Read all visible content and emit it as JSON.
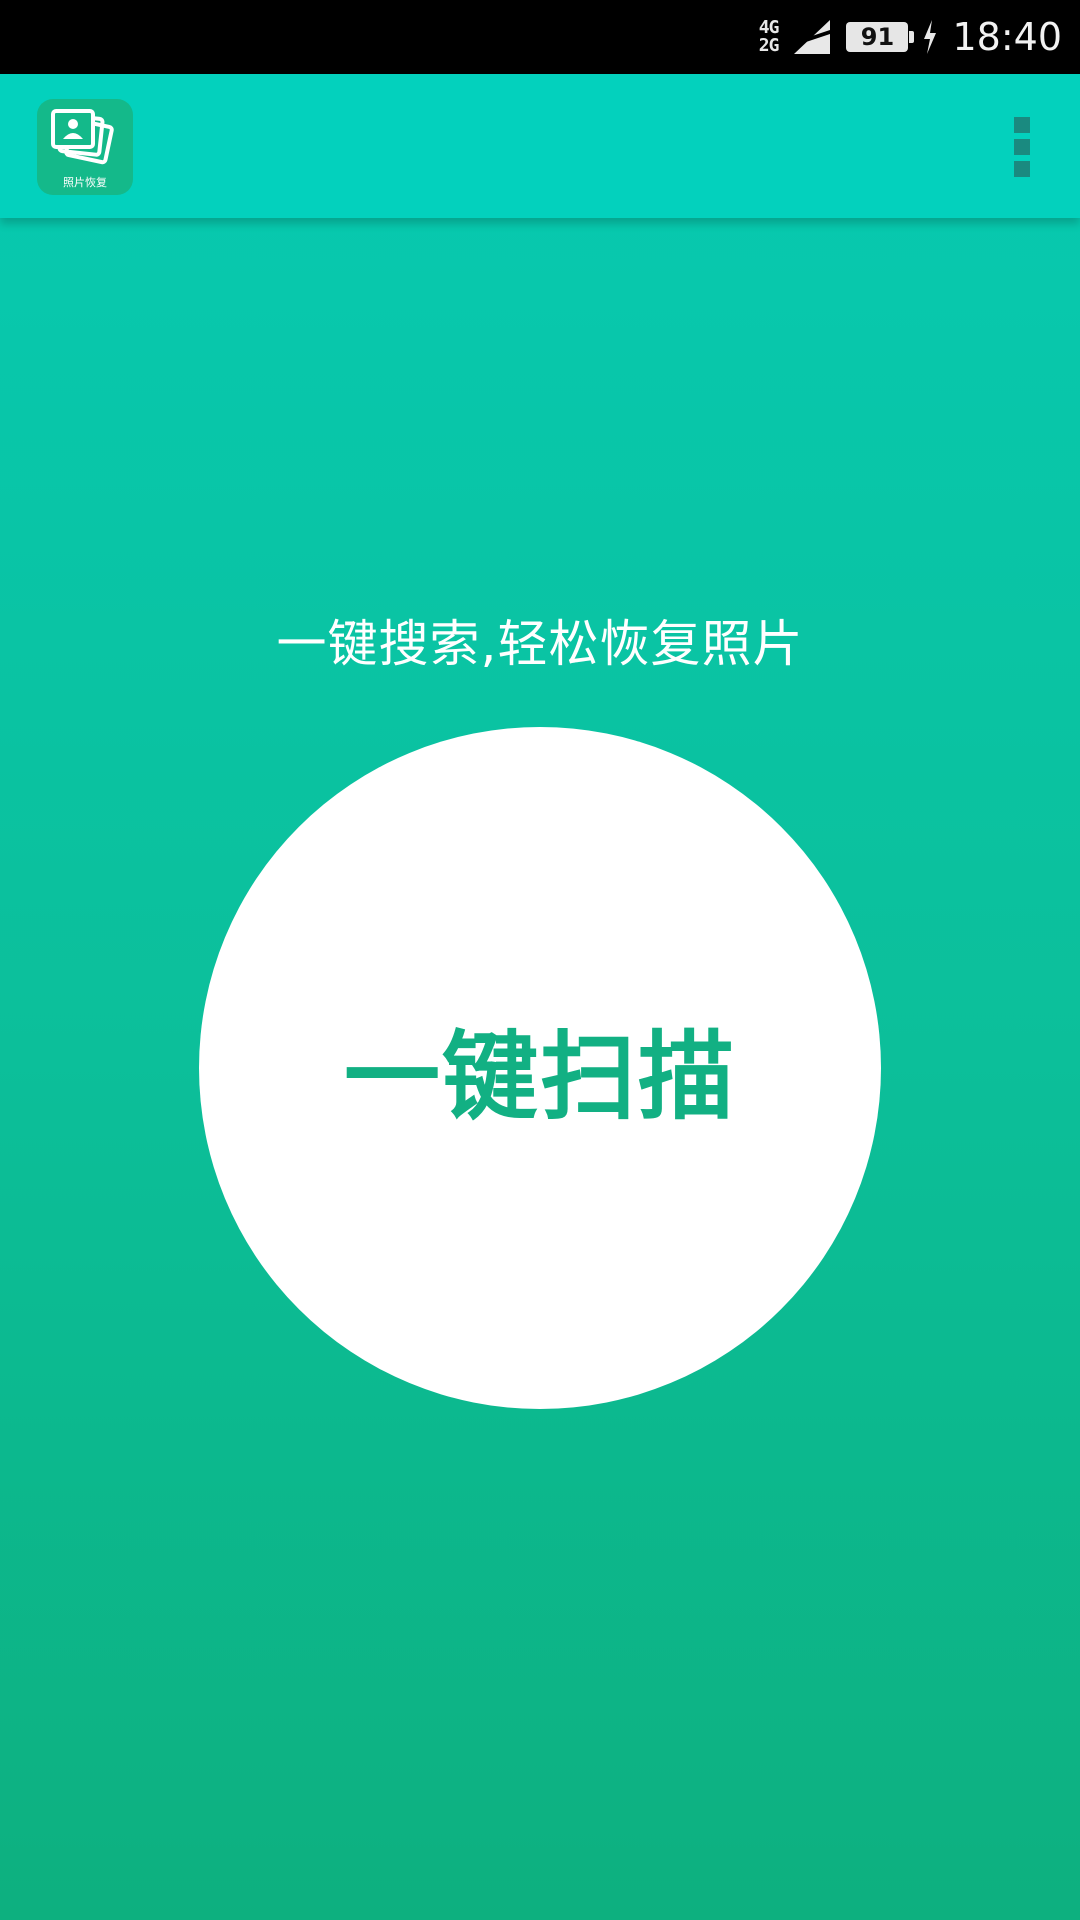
{
  "status_bar": {
    "network_top": "4G",
    "network_bottom": "2G",
    "battery_level": "91",
    "charging": true,
    "time": "18:40"
  },
  "app_bar": {
    "logo_label": "照片恢复",
    "logo_icon": "photo-stack-icon",
    "menu_icon": "overflow-menu-icon"
  },
  "main": {
    "tagline": "一键搜索,轻松恢复照片",
    "scan_button_label": "一键扫描"
  },
  "colors": {
    "app_bar": "#03d1bd",
    "gradient_top": "#06cbb3",
    "gradient_bottom": "#0db07f",
    "scan_text": "#12b083",
    "logo_bg": "#14b98a"
  }
}
